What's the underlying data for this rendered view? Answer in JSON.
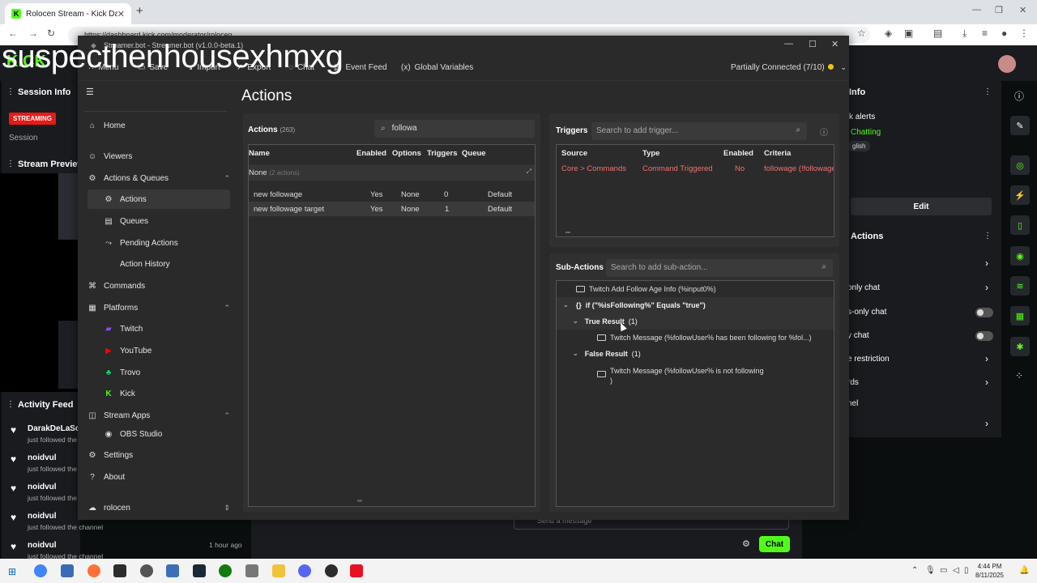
{
  "browser": {
    "tab_title": "Rolocen Stream - Kick Dashbo",
    "url": "https://dashboard.kick.com/moderator/rolocen"
  },
  "overlay_text": "suspecthenhousexhmxg",
  "kick": {
    "logo": "KICK",
    "session_info": "Session Info",
    "streaming_badge": "STREAMING",
    "session": "Session",
    "stream_preview": "Stream Preview",
    "activity_feed": "Activity Feed",
    "activity": [
      {
        "name": "DarakDeLaSo",
        "sub": "just followed the"
      },
      {
        "name": "noidvul",
        "sub": "just followed the"
      },
      {
        "name": "noidvul",
        "sub": "just followed the"
      },
      {
        "name": "noidvul",
        "sub": "just followed the channel"
      },
      {
        "name": "noidvul",
        "sub": "just followed the channel",
        "time": "1 hour ago"
      }
    ],
    "chat_button": "Chat",
    "chat_placeholder": "Send a message",
    "right_panel": {
      "info_title": "Info",
      "alerts": "k alerts",
      "chatting": "Chatting",
      "language": "glish",
      "edit": "Edit",
      "actions_title": "Actions",
      "rows": [
        "only chat",
        "s-only chat",
        "y chat",
        "e restriction",
        "rds",
        "nel"
      ]
    }
  },
  "streamerbot": {
    "window_title": "Streamer.bot - Streamer.bot (v1.0.0-beta.1)",
    "menubar": {
      "menu": "Menu",
      "save": "Save",
      "import": "Import",
      "export": "Export",
      "chat": "Chat",
      "event_feed": "Event Feed",
      "global_variables": "Global Variables",
      "connection": "Partially Connected (7/10)"
    },
    "nav": {
      "home": "Home",
      "viewers": "Viewers",
      "actions_queues": "Actions & Queues",
      "actions": "Actions",
      "queues": "Queues",
      "pending_actions": "Pending Actions",
      "action_history": "Action History",
      "commands": "Commands",
      "platforms": "Platforms",
      "twitch": "Twitch",
      "youtube": "YouTube",
      "trovo": "Trovo",
      "kick": "Kick",
      "stream_apps": "Stream Apps",
      "obs_studio": "OBS Studio",
      "settings": "Settings",
      "about": "About",
      "profile": "rolocen"
    },
    "page_title": "Actions",
    "actions_panel": {
      "title": "Actions",
      "count": "(263)",
      "search_value": "followa",
      "columns": [
        "Name",
        "Enabled",
        "Options",
        "Triggers",
        "Queue"
      ],
      "group": "None",
      "group_count": "(2 actions)",
      "rows": [
        {
          "name": "new followage",
          "enabled": "Yes",
          "options": "None",
          "triggers": "0",
          "queue": "Default"
        },
        {
          "name": "new followage target",
          "enabled": "Yes",
          "options": "None",
          "triggers": "1",
          "queue": "Default"
        }
      ]
    },
    "triggers": {
      "title": "Triggers",
      "placeholder": "Search to add trigger...",
      "columns": [
        "Source",
        "Type",
        "Enabled",
        "Criteria"
      ],
      "row": {
        "source": "Core > Commands",
        "type": "Command Triggered",
        "enabled": "No",
        "criteria": "followage (!followage"
      }
    },
    "subactions": {
      "title": "Sub-Actions",
      "placeholder": "Search to add sub-action...",
      "items": {
        "follow_age": "Twitch Add Follow Age Info (%input0%)",
        "if_cond": "if (\"%isFollowing%\" Equals \"true\")",
        "true_label": "True Result",
        "true_count": "(1)",
        "true_msg": "Twitch Message (%followUser% has been following for %fol...)",
        "false_label": "False Result",
        "false_count": "(1)",
        "false_msg": "Twitch Message (%followUser% is not following",
        "false_msg_end": ")"
      }
    }
  },
  "taskbar": {
    "time": "4:44 PM",
    "date": "8/11/2025"
  }
}
